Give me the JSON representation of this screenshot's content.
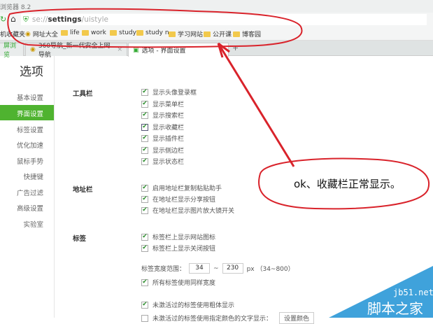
{
  "window": {
    "title": "浏览器 8.2"
  },
  "address": {
    "scheme": "se://",
    "host": "settings",
    "path": "/uistyle"
  },
  "bookmarks": {
    "label": "机收藏夹",
    "items": [
      "网址大全",
      "life",
      "work",
      "study",
      "study n",
      "学习网站",
      "公开课",
      "博客园"
    ]
  },
  "tabs": [
    {
      "label": "屏浏览"
    },
    {
      "label": "360导航_新一代安全上网导航",
      "close": "×"
    },
    {
      "label": "选项 - 界面设置",
      "close": "×"
    },
    {
      "label": "+"
    }
  ],
  "page": {
    "title": "选项"
  },
  "sidebar": {
    "items": [
      "基本设置",
      "界面设置",
      "标签设置",
      "优化加速",
      "鼠标手势",
      "快捷键",
      "广告过滤",
      "高级设置",
      "实验室"
    ],
    "active": 1
  },
  "sections": {
    "toolbar": {
      "label": "工具栏",
      "options": [
        "显示头像登录框",
        "显示菜单栏",
        "显示搜索栏",
        "显示收藏栏",
        "显示插件栏",
        "显示侧边栏",
        "显示状态栏"
      ]
    },
    "addressbar": {
      "label": "地址栏",
      "options": [
        "启用地址栏复制粘贴助手",
        "在地址栏显示分享按钮",
        "在地址栏显示图片放大镜开关"
      ]
    },
    "tabs": {
      "label": "标签",
      "options": [
        "标签栏上显示网站图标",
        "标签栏上显示关闭按钮"
      ],
      "width_label": "标签宽度范围：",
      "width_min": "34",
      "tilde": "~",
      "width_max": "230",
      "width_unit": "px （34~800）",
      "same_width": "所有标签使用同样宽度",
      "bold_inactive": "未激活过的标签使用粗体显示",
      "color_inactive": "未激活过的标签使用指定颜色的文字显示：",
      "color_button": "设置颜色"
    }
  },
  "annotation": {
    "text": "ok、收藏栏正常显示。",
    "color": "#d9232b"
  },
  "watermark": {
    "site": "jb51.net",
    "name": "脚本之家"
  }
}
